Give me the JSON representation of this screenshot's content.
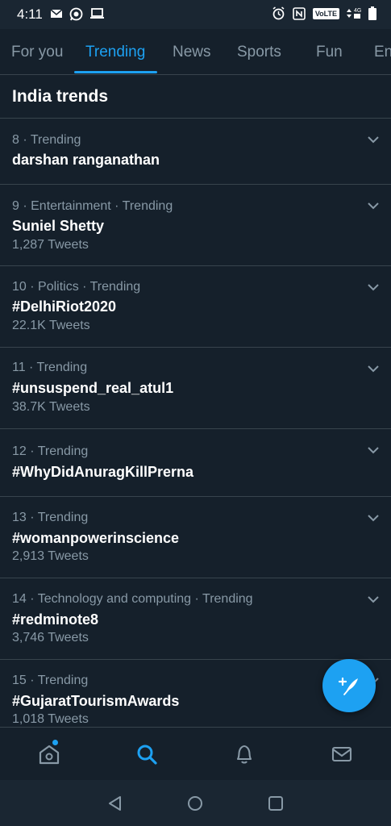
{
  "status_bar": {
    "time": "4:11",
    "left_icons": [
      "gmail-icon",
      "whatsapp-icon",
      "laptop-icon"
    ],
    "right_icons": [
      "alarm-icon",
      "nfc-icon",
      "volte-icon",
      "network-4g-icon",
      "battery-icon"
    ],
    "volte_label": "VoLTE",
    "network_label": "4G"
  },
  "tabs": [
    {
      "label": "For you",
      "active": false
    },
    {
      "label": "Trending",
      "active": true
    },
    {
      "label": "News",
      "active": false
    },
    {
      "label": "Sports",
      "active": false
    },
    {
      "label": "Fun",
      "active": false
    },
    {
      "label": "En",
      "active": false
    }
  ],
  "section": {
    "title": "India trends"
  },
  "trends": [
    {
      "meta": "8 · Trending",
      "name": "darshan ranganathan",
      "count": ""
    },
    {
      "meta": "9 · Entertainment · Trending",
      "name": "Suniel Shetty",
      "count": "1,287 Tweets"
    },
    {
      "meta": "10 · Politics · Trending",
      "name": "#DelhiRiot2020",
      "count": "22.1K Tweets"
    },
    {
      "meta": "11 · Trending",
      "name": "#unsuspend_real_atul1",
      "count": "38.7K Tweets"
    },
    {
      "meta": "12 · Trending",
      "name": "#WhyDidAnuragKillPrerna",
      "count": ""
    },
    {
      "meta": "13 · Trending",
      "name": "#womanpowerinscience",
      "count": "2,913 Tweets"
    },
    {
      "meta": "14 · Technology and computing · Trending",
      "name": "#redminote8",
      "count": "3,746 Tweets"
    },
    {
      "meta": "15 · Trending",
      "name": "#GujaratTourismAwards",
      "count": "1,018 Tweets"
    }
  ],
  "fab": {
    "icon": "compose-tweet-icon"
  },
  "bottom_nav": {
    "items": [
      "home-icon",
      "search-icon",
      "notifications-icon",
      "messages-icon"
    ],
    "active": "search-icon",
    "accent": "#1da1f2"
  },
  "system_nav": [
    "back-icon",
    "home-circle-icon",
    "recents-icon"
  ],
  "colors": {
    "background": "#15202b",
    "accent": "#1da1f2",
    "secondary_text": "#8899a6",
    "divider": "#38444d"
  }
}
